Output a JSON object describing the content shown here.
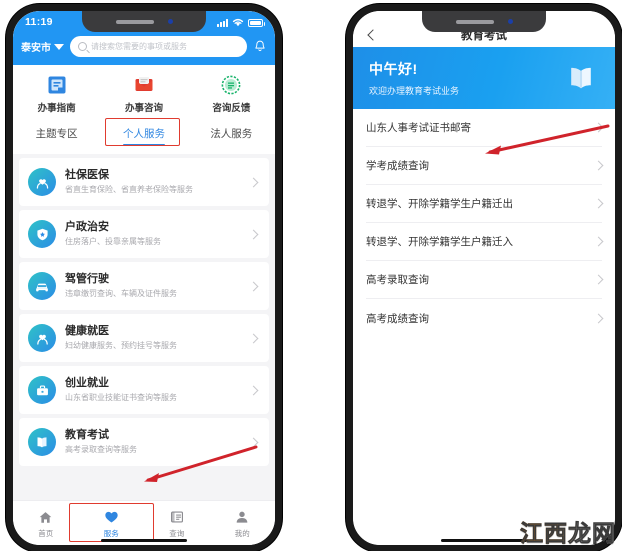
{
  "left_phone": {
    "status_bar": {
      "time": "11:19",
      "signal_icon": "signal-bars-icon",
      "wifi_icon": "wifi-icon",
      "battery_icon": "battery-icon"
    },
    "header": {
      "city": "泰安市",
      "city_caret_icon": "chevron-down-icon",
      "search_placeholder": "请搜索您需要的事项或服务",
      "search_icon": "search-icon",
      "bell_icon": "bell-icon"
    },
    "quick_actions": [
      {
        "label": "办事指南",
        "icon": "guide-icon",
        "color": "#2f86e0"
      },
      {
        "label": "办事咨询",
        "icon": "mail-icon",
        "color": "#e03b2f"
      },
      {
        "label": "咨询反馈",
        "icon": "feedback-icon",
        "color": "#19b36b"
      }
    ],
    "tabs": [
      {
        "label": "主题专区",
        "active": false
      },
      {
        "label": "个人服务",
        "active": true
      },
      {
        "label": "法人服务",
        "active": false
      }
    ],
    "services": [
      {
        "title": "社保医保",
        "desc": "省直生育保险、省直养老保险等服务",
        "icon": "heart-hands-icon"
      },
      {
        "title": "户政治安",
        "desc": "住房落户、投靠亲属等服务",
        "icon": "shield-star-icon"
      },
      {
        "title": "驾管行驶",
        "desc": "违章缴罚查询、车辆及证件服务",
        "icon": "car-icon"
      },
      {
        "title": "健康就医",
        "desc": "妇幼健康服务、预约挂号等服务",
        "icon": "health-heart-icon"
      },
      {
        "title": "创业就业",
        "desc": "山东省职业技能证书查询等服务",
        "icon": "briefcase-icon"
      },
      {
        "title": "教育考试",
        "desc": "高考录取查询等服务",
        "icon": "book-icon"
      }
    ],
    "tab_bar": [
      {
        "label": "首页",
        "icon": "home-icon",
        "active": false
      },
      {
        "label": "服务",
        "icon": "heart-icon",
        "active": true
      },
      {
        "label": "查询",
        "icon": "list-icon",
        "active": false
      },
      {
        "label": "我的",
        "icon": "person-icon",
        "active": false
      }
    ]
  },
  "right_phone": {
    "nav": {
      "title": "教育考试",
      "back_icon": "back-chevron-icon"
    },
    "banner": {
      "greeting": "中午好!",
      "subtitle": "欢迎办理教育考试业务",
      "icon": "book-icon"
    },
    "items": [
      {
        "label": "山东人事考试证书邮寄"
      },
      {
        "label": "学考成绩查询"
      },
      {
        "label": "转退学、开除学籍学生户籍迁出"
      },
      {
        "label": "转退学、开除学籍学生户籍迁入"
      },
      {
        "label": "高考录取查询"
      },
      {
        "label": "高考成绩查询"
      }
    ]
  },
  "annotations": {
    "arrow_color": "#d0232b",
    "highlight_color": "#e03b2f",
    "watermark": "江西龙网"
  },
  "theme": {
    "primary": "#2196f3",
    "accent": "#2f86e0",
    "page_bg": "#f4f4f6"
  }
}
